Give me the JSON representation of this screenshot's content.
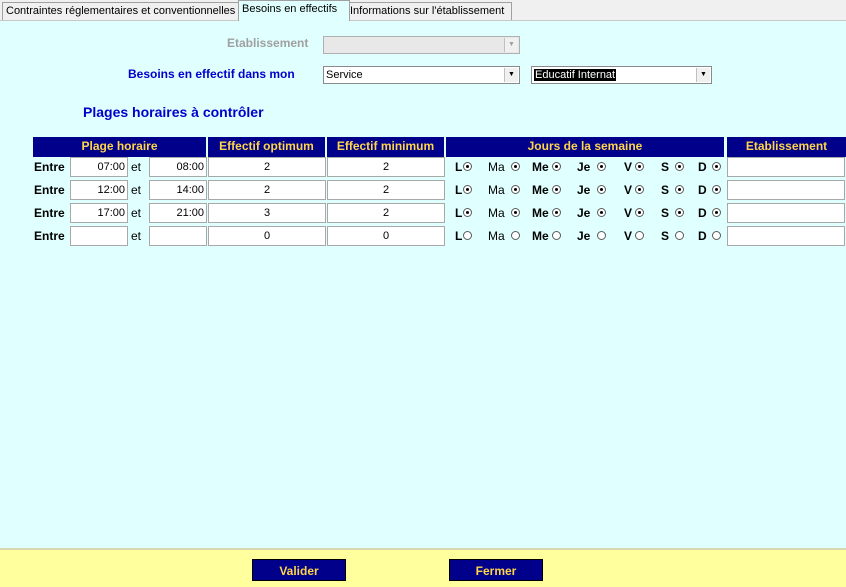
{
  "tabs": [
    {
      "label": "Contraintes réglementaires et conventionnelles"
    },
    {
      "label": "Besoins en effectifs"
    },
    {
      "label": "Informations sur l'établissement"
    }
  ],
  "form": {
    "etablissement_label": "Etablissement",
    "etablissement_value": "",
    "besoins_label": "Besoins en effectif dans mon",
    "service_value": "Service",
    "service2_value": "Educatif Internat",
    "section_title": "Plages horaires à contrôler"
  },
  "table": {
    "headers": [
      "Plage horaire",
      "Effectif optimum",
      "Effectif minimum",
      "Jours de la semaine",
      "Etablissement"
    ],
    "row_label": "Entre",
    "et_label": "et",
    "days": [
      "L",
      "Ma",
      "Me",
      "Je",
      "V",
      "S",
      "D"
    ],
    "rows": [
      {
        "start": "07:00",
        "end": "08:00",
        "optimum": "2",
        "minimum": "2",
        "days_checked": [
          true,
          true,
          true,
          true,
          true,
          true,
          true
        ],
        "etab": ""
      },
      {
        "start": "12:00",
        "end": "14:00",
        "optimum": "2",
        "minimum": "2",
        "days_checked": [
          true,
          true,
          true,
          true,
          true,
          true,
          true
        ],
        "etab": ""
      },
      {
        "start": "17:00",
        "end": "21:00",
        "optimum": "3",
        "minimum": "2",
        "days_checked": [
          true,
          true,
          true,
          true,
          true,
          true,
          true
        ],
        "etab": ""
      },
      {
        "start": "",
        "end": "",
        "optimum": "0",
        "minimum": "0",
        "days_checked": [
          false,
          false,
          false,
          false,
          false,
          false,
          false
        ],
        "etab": ""
      }
    ]
  },
  "buttons": {
    "valider": "Valider",
    "fermer": "Fermer"
  },
  "colors": {
    "header_bg": "#00008b",
    "header_text": "#ffd54a",
    "panel_bg": "#e0ffff",
    "footer_bg": "#ffff9e",
    "label_blue": "#0000cd"
  }
}
